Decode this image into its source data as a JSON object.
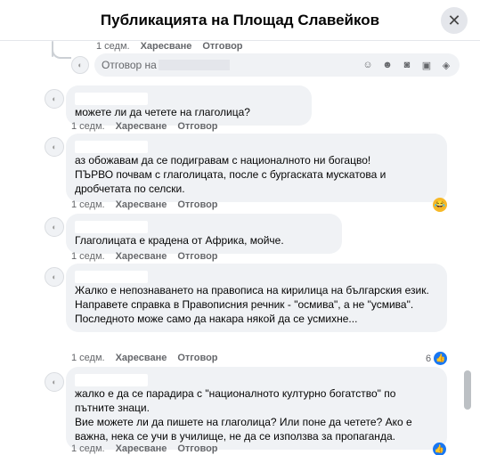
{
  "header": {
    "title": "Публикацията на Площад Славейков"
  },
  "actions": {
    "time": "1 седм.",
    "like": "Харесване",
    "reply": "Отговор"
  },
  "reply_box": {
    "placeholder": "Отговор на"
  },
  "comments": [
    {
      "text": "можете ли да четете на глаголица?"
    },
    {
      "text": "аз обожавам да се подигравам с националното ни богацво!\nПЪРВО почвам с глаголицата, после с бургаската мускатова и дробчетата по селски."
    },
    {
      "text": "Глаголицата е крадена от Африка, мойче."
    },
    {
      "text": "Жалко е непознаването на правописа на кирилица на българския език.\nНаправете справка в Правописния речник - \"осмива\", а не \"усмива\".\nПоследното може само да накара някой да се усмихне...",
      "likes": "6"
    },
    {
      "text": "жалко е да се парадира с \"националното културно богатство\" по пътните знаци.\nВие можете ли да пишете на глаголица? Или поне да четете? Ако е важна, нека се учи в училище, не да се използва за пропаганда."
    }
  ]
}
